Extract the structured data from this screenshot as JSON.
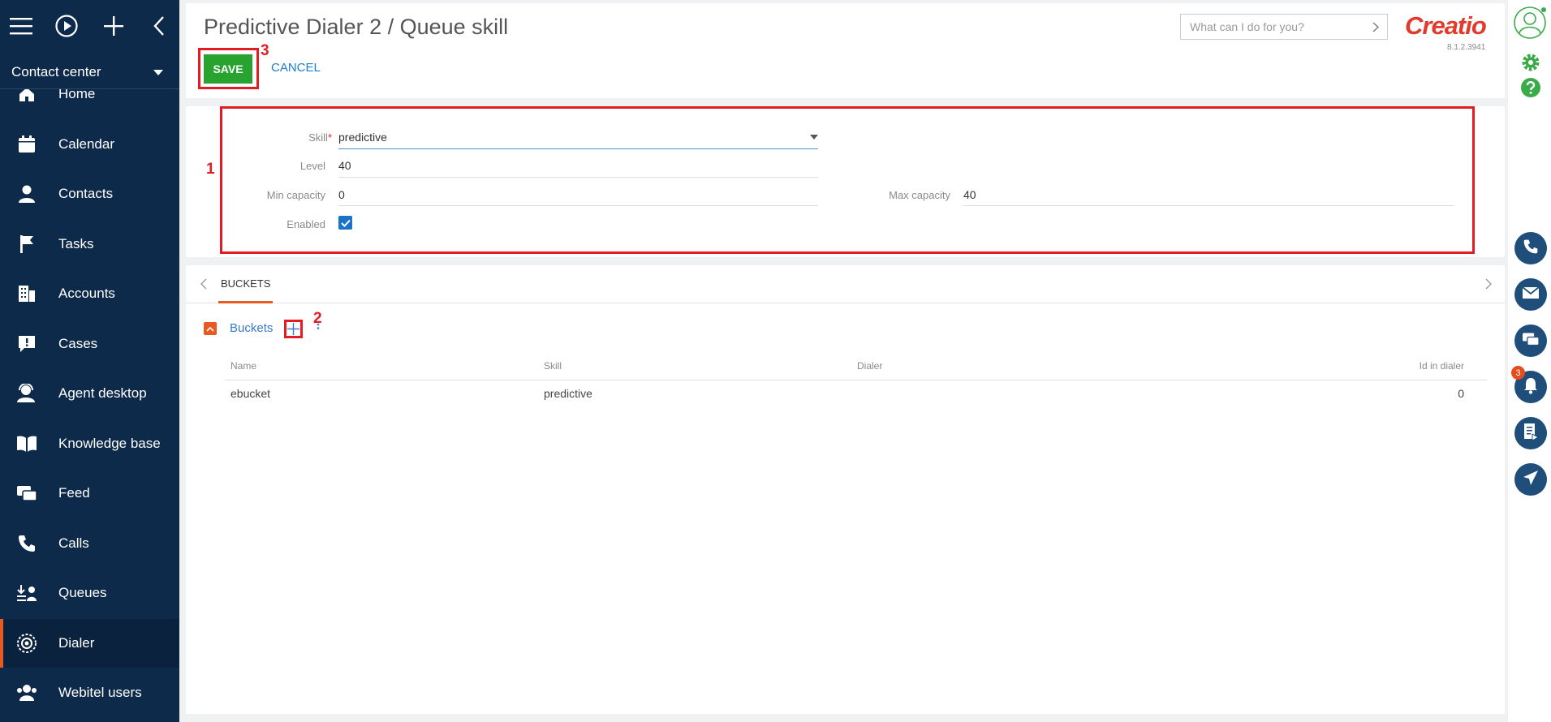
{
  "sidebar": {
    "workspace": "Contact center",
    "items": [
      {
        "label": "Home",
        "icon": "home-icon"
      },
      {
        "label": "Calendar",
        "icon": "calendar-icon"
      },
      {
        "label": "Contacts",
        "icon": "contact-icon"
      },
      {
        "label": "Tasks",
        "icon": "flag-icon"
      },
      {
        "label": "Accounts",
        "icon": "building-icon"
      },
      {
        "label": "Cases",
        "icon": "case-icon"
      },
      {
        "label": "Agent desktop",
        "icon": "agent-icon"
      },
      {
        "label": "Knowledge base",
        "icon": "book-icon"
      },
      {
        "label": "Feed",
        "icon": "chat-icon"
      },
      {
        "label": "Calls",
        "icon": "phone-icon"
      },
      {
        "label": "Queues",
        "icon": "queue-icon"
      },
      {
        "label": "Dialer",
        "icon": "dialer-icon",
        "active": true
      },
      {
        "label": "Webitel users",
        "icon": "users-icon"
      }
    ]
  },
  "header": {
    "title": "Predictive Dialer 2 / Queue skill",
    "save_label": "SAVE",
    "cancel_label": "CANCEL",
    "search_placeholder": "What can I do for you?",
    "logo_text": "Creatio",
    "version": "8.1.2.3941"
  },
  "annotations": {
    "one": "1",
    "two": "2",
    "three": "3"
  },
  "form": {
    "skill_label": "Skill",
    "skill_value": "predictive",
    "level_label": "Level",
    "level_value": "40",
    "min_capacity_label": "Min capacity",
    "min_capacity_value": "0",
    "max_capacity_label": "Max capacity",
    "max_capacity_value": "40",
    "enabled_label": "Enabled",
    "enabled": true
  },
  "detail": {
    "tab": "BUCKETS",
    "group_title": "Buckets",
    "columns": [
      "Name",
      "Skill",
      "Dialer",
      "Id in dialer"
    ],
    "rows": [
      {
        "name": "ebucket",
        "skill": "predictive",
        "dialer": "",
        "id_in_dialer": "0"
      }
    ]
  },
  "rail": {
    "notification_count": "3"
  },
  "colors": {
    "sidebar": "#0e2a4a",
    "accent": "#e85a21",
    "save": "#29a330",
    "highlight": "#e31b23",
    "rail_button": "#1f4e7a"
  }
}
